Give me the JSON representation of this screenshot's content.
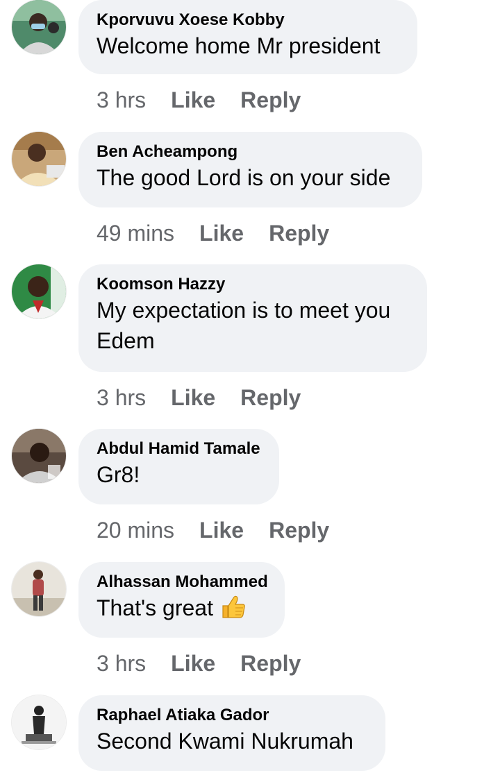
{
  "comments": [
    {
      "author": "Kporvuvu Xoese Kobby",
      "text": "Welcome home Mr president",
      "time": "3 hrs",
      "like": "Like",
      "reply": "Reply"
    },
    {
      "author": "Ben Acheampong",
      "text": "The good Lord is on your side",
      "time": "49 mins",
      "like": "Like",
      "reply": "Reply"
    },
    {
      "author": "Koomson Hazzy",
      "text_line1": "My expectation is to meet you",
      "text_line2": "Edem",
      "time": "3 hrs",
      "like": "Like",
      "reply": "Reply"
    },
    {
      "author": "Abdul Hamid Tamale",
      "text": "Gr8!",
      "time": "20 mins",
      "like": "Like",
      "reply": "Reply"
    },
    {
      "author": "Alhassan Mohammed",
      "text": "That's great",
      "emoji": "thumbs-up",
      "time": "3 hrs",
      "like": "Like",
      "reply": "Reply"
    },
    {
      "author": "Raphael Atiaka Gador",
      "text": "Second Kwami Nukrumah"
    }
  ],
  "colors": {
    "bubble": "#f0f2f5",
    "meta": "#65676b",
    "text": "#050505"
  }
}
